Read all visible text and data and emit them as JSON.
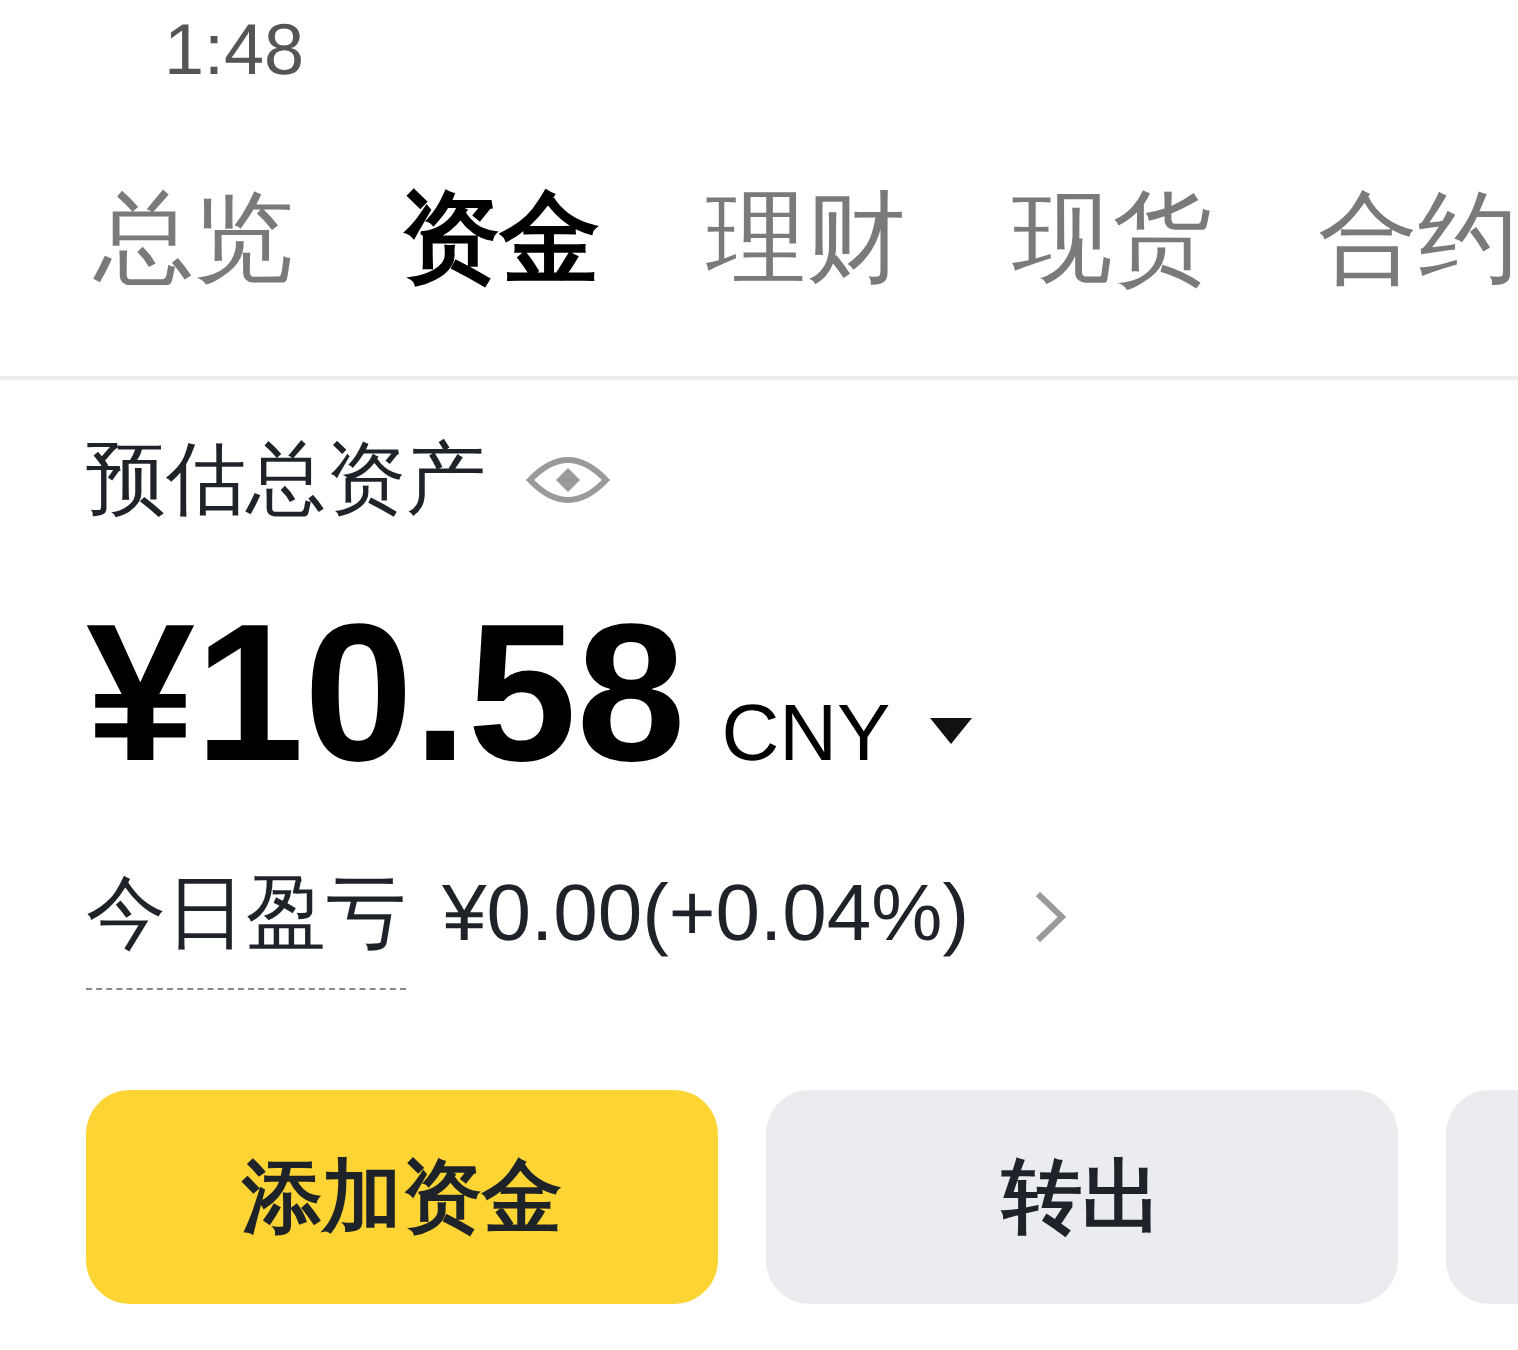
{
  "status_bar": {
    "time": "1:48"
  },
  "tabs": [
    {
      "label": "总览",
      "selected": false
    },
    {
      "label": "资金",
      "selected": true
    },
    {
      "label": "理财",
      "selected": false
    },
    {
      "label": "现货",
      "selected": false
    },
    {
      "label": "合约",
      "selected": false
    }
  ],
  "balance": {
    "label": "预估总资产",
    "amount": "¥10.58",
    "currency": "CNY"
  },
  "pnl": {
    "label": "今日盈亏",
    "value": "¥0.00(+0.04%)"
  },
  "buttons": [
    {
      "label": "添加资金",
      "kind": "primary"
    },
    {
      "label": "转出",
      "kind": "secondary"
    },
    {
      "kind": "secondary"
    }
  ]
}
